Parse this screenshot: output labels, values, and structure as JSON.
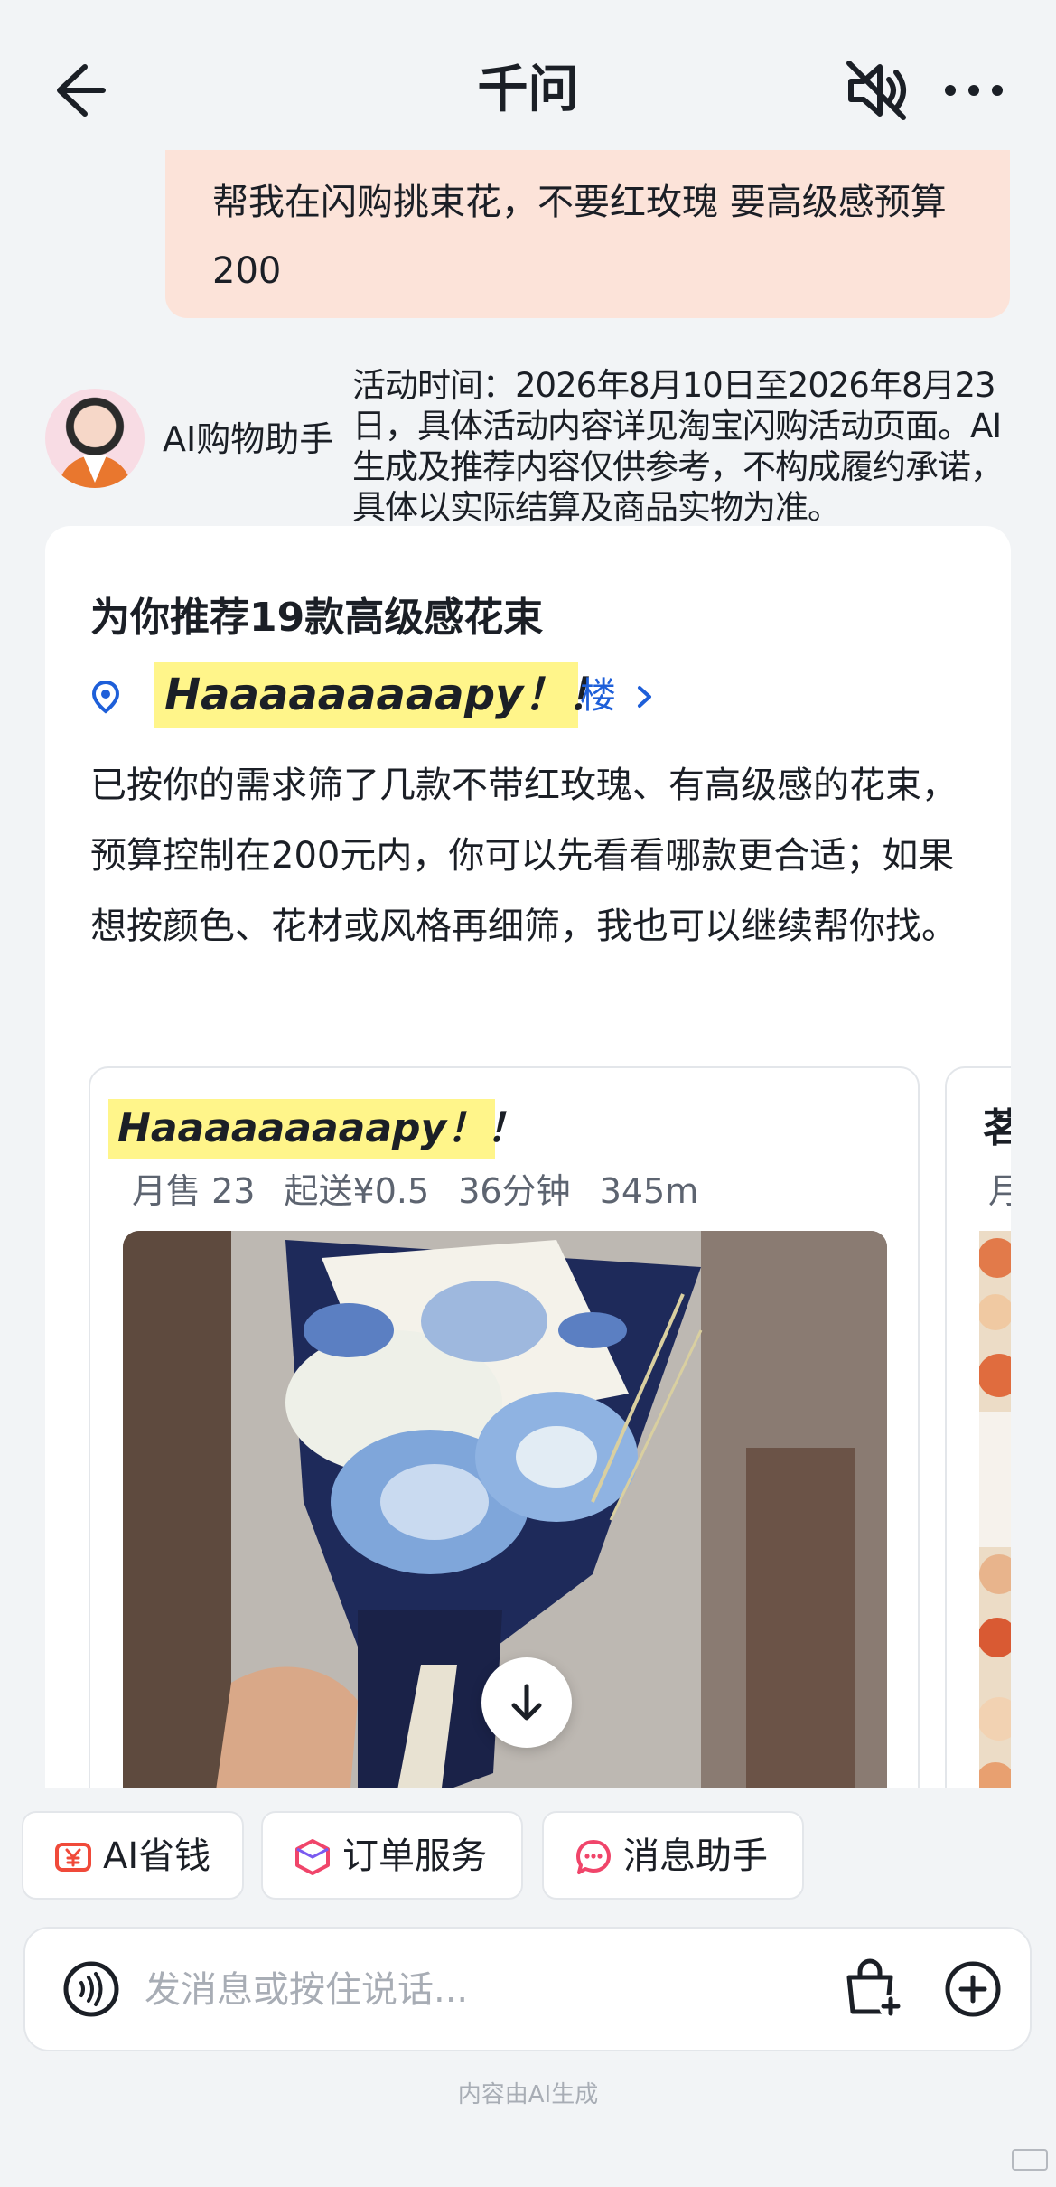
{
  "header": {
    "title": "千问"
  },
  "user_message": {
    "text": "帮我在闪购挑束花，不要红玫瑰 要高级感预算200"
  },
  "assistant": {
    "name": "AI购物助手",
    "disclaimer": "活动时间：2026年8月10日至2026年8月23日，具体活动内容详见淘宝闪购活动页面。AI生成及推荐内容仅供参考，不构成履约承诺，具体以实际结算及商品实物为准。"
  },
  "card": {
    "title": "为你推荐19款高级感花束",
    "store_name": "Haaaaaaaaapy！！",
    "store_suffix": "楼",
    "reply": "已按你的需求筛了几款不带红玫瑰、有高级感的花束，预算控制在200元内，你可以先看看哪款更合适；如果想按颜色、花材或风格再细筛，我也可以继续帮你找。",
    "products": [
      {
        "name": "Haaaaaaaaapy！！",
        "monthly_sales": "月售 23",
        "min_order": "起送¥0.5",
        "delivery_time": "36分钟",
        "distance": "345m"
      },
      {
        "name": "茗",
        "monthly_sales": "月"
      }
    ]
  },
  "quick_actions": [
    {
      "label": "AI省钱",
      "icon": "yen-coupon-icon",
      "color": "#F04A3A"
    },
    {
      "label": "订单服务",
      "icon": "box-icon",
      "color": "#F0456A"
    },
    {
      "label": "消息助手",
      "icon": "chat-bubble-icon",
      "color": "#F0456A"
    }
  ],
  "input": {
    "placeholder": "发消息或按住说话..."
  },
  "footer": {
    "note": "内容由AI生成"
  },
  "colors": {
    "highlight": "#FFF58A",
    "user_bubble": "#FCE3D9",
    "link": "#1E5FD9",
    "background": "#F2F4F6"
  }
}
